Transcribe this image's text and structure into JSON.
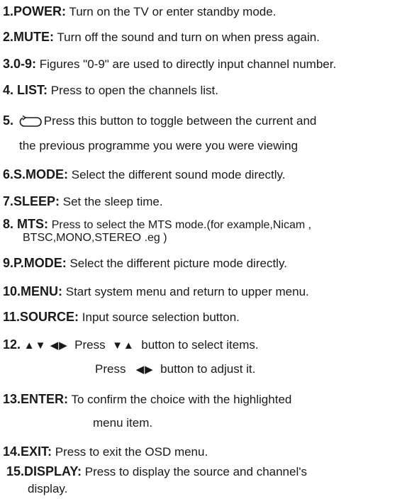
{
  "items": [
    {
      "key": "1.POWER:",
      "desc": "Turn on the TV or enter standby mode."
    },
    {
      "key": "2.MUTE:",
      "desc": "Turn off the sound and turn on when press again."
    },
    {
      "key": "3.0-9:",
      "desc": "Figures \"0-9\" are used to directly input channel number."
    },
    {
      "key": "4. LIST:",
      "desc": "Press to open the channels list."
    },
    {
      "key": "5.",
      "desc": "Press this button to toggle between the current and",
      "cont": "the previous programme you were you were viewing"
    },
    {
      "key": "6.S.MODE:",
      "desc": "Select the different sound mode directly."
    },
    {
      "key": "7.SLEEP:",
      "desc": "Set the sleep time."
    },
    {
      "key": "8.  MTS:",
      "desc": "Press to select the MTS mode.(for example,Nicam ,",
      "cont": "BTSC,MONO,STEREO .eg )"
    },
    {
      "key": "9.P.MODE:",
      "desc": "Select the different picture mode directly."
    },
    {
      "key": "10.MENU:",
      "desc": "Start system menu and return to upper menu."
    },
    {
      "key": "11.SOURCE:",
      "desc": "Input source selection  button."
    },
    {
      "key": "12.",
      "arrows": "▲▼ ◀▶",
      "desc": "Press",
      "desc_arrows": "▼▲",
      "desc_tail": "button to select items.",
      "line2_a": "Press",
      "line2_arrows": "◀▶",
      "line2_tail": "button to adjust it."
    },
    {
      "key": "13.ENTER:",
      "desc": "To confirm the choice with the highlighted",
      "cont": "menu item."
    },
    {
      "key": "14.EXIT:",
      "desc": "Press to exit the OSD menu."
    },
    {
      "key": "15.DISPLAY:",
      "desc": "Press to display the source and channel's",
      "cont": "display."
    }
  ]
}
